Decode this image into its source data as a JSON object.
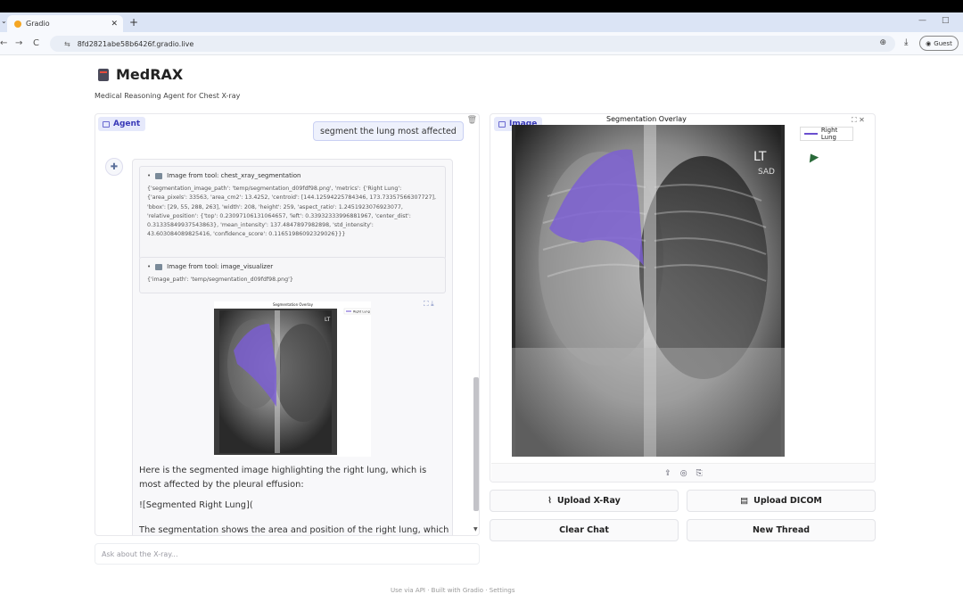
{
  "browser": {
    "tab_title": "Gradio",
    "url": "8fd2821abe58b6426f.gradio.live",
    "profile": "Guest"
  },
  "app": {
    "title": "MedRAX",
    "subtitle": "Medical Reasoning Agent for Chest X-ray"
  },
  "agent": {
    "label": "Agent",
    "user_message": "segment the lung most affected",
    "tool1_title": "Image from tool: chest_xray_segmentation",
    "tool1_body": "{'segmentation_image_path': 'temp/segmentation_d09fdf98.png', 'metrics': {'Right Lung': {'area_pixels': 33563, 'area_cm2': 13.4252, 'centroid': [144.12594225784346, 173.73357566307727], 'bbox': [29, 55, 288, 263], 'width': 208, 'height': 259, 'aspect_ratio': 1.2451923076923077, 'relative_position': {'top': 0.2309710613106465​7, 'left': 0.33932333996881967, 'center_dist': 0.31335849937543863}, 'mean_intensity': 137.4847897982898, 'std_intensity': 43.603084089825416, 'confidence_score': 0.11651986092329026}}}",
    "tool2_title": "Image from tool: image_visualizer",
    "tool2_body": "{'image_path': 'temp/segmentation_d09fdf98.png'}",
    "mini_title": "Segmentation Overlay",
    "mini_legend": "Right Lung",
    "response_p1": "Here is the segmented image highlighting the right lung, which is most affected by the pleural effusion:",
    "response_p2": "![Segmented Right Lung](",
    "response_p3": "The segmentation shows the area and position of the right lung, which",
    "input_placeholder": "Ask about the X-ray..."
  },
  "image": {
    "label": "Image",
    "overlay_title": "Segmentation Overlay",
    "legend": "Right Lung",
    "marker_lt": "LT",
    "marker_sad": "SAD"
  },
  "buttons": {
    "upload_xray": "Upload X-Ray",
    "upload_dicom": "Upload DICOM",
    "clear_chat": "Clear Chat",
    "new_thread": "New Thread"
  },
  "footer": "Use via API · Built with Gradio · Settings",
  "colors": {
    "accent": "#3a3ab8",
    "overlay": "#7b5cd6"
  }
}
